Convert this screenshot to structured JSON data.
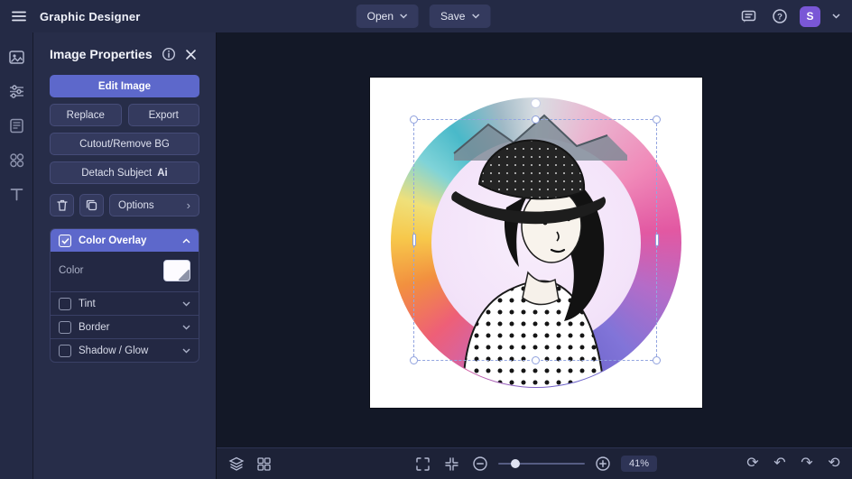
{
  "topbar": {
    "title": "Graphic Designer",
    "open_label": "Open",
    "save_label": "Save",
    "avatar_initial": "S",
    "help_glyph": "?"
  },
  "panel": {
    "title": "Image Properties",
    "edit_label": "Edit Image",
    "replace_label": "Replace",
    "export_label": "Export",
    "cutout_label": "Cutout/Remove BG",
    "detach_label": "Detach Subject",
    "detach_badge": "Ai",
    "options_label": "Options",
    "color_overlay_label": "Color Overlay",
    "color_label": "Color",
    "tint_label": "Tint",
    "border_label": "Border",
    "shadow_label": "Shadow / Glow"
  },
  "canvas": {
    "zoom_level": "41%"
  },
  "icons": {
    "options_chevron": "›",
    "undo": "↶",
    "redo": "↷",
    "rotate": "⟳",
    "history": "⟲"
  },
  "colors": {
    "accent": "#5d68cb",
    "avatar": "#7a57d6",
    "bg-top": "#242a45",
    "bg-panel": "#272d49",
    "bg-canvas": "#131827"
  }
}
